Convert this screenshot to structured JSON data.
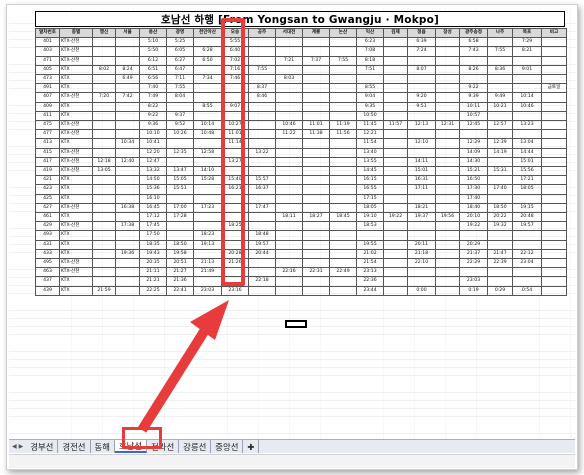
{
  "title": "호남선 하행 [From Yongsan to Gwangju · Mokpo]",
  "columns": [
    "열차번호",
    "종별",
    "행신",
    "서울",
    "용산",
    "광명",
    "천안아산",
    "오송",
    "공주",
    "서대전",
    "계룡",
    "논산",
    "익산",
    "김제",
    "정읍",
    "장성",
    "광주송정",
    "나주",
    "목포",
    "비고"
  ],
  "rows": [
    [
      "401",
      "KTX-산천",
      "",
      "",
      "5:10",
      "5:25",
      "",
      "5:55",
      "",
      "",
      "",
      "",
      "6:23",
      "",
      "6:39",
      "",
      "6:58",
      "",
      "7:29",
      ""
    ],
    [
      "403",
      "KTX-산천",
      "",
      "",
      "5:50",
      "6:05",
      "6:28",
      "6:40",
      "",
      "",
      "",
      "",
      "7:08",
      "",
      "7:24",
      "",
      "7:43",
      "7:55",
      "8:21",
      ""
    ],
    [
      "471",
      "KTX-산천",
      "",
      "",
      "6:12",
      "6:27",
      "6:50",
      "7:02",
      "",
      "7:21",
      "7:37",
      "7:55",
      "8:18",
      "",
      "",
      "",
      "",
      "",
      "",
      ""
    ],
    [
      "405",
      "KTX",
      "8:02",
      "8:24",
      "6:51",
      "6:47",
      "",
      "7:16",
      "7:55",
      "",
      "",
      "",
      "7:51",
      "",
      "8:07",
      "",
      "8:26",
      "8:36",
      "9:01",
      ""
    ],
    [
      "473",
      "KTX",
      "",
      "6:49",
      "6:56",
      "7:11",
      "7:34",
      "7:46",
      "",
      "8:03",
      "",
      "",
      "",
      "",
      "",
      "",
      "",
      "",
      "",
      ""
    ],
    [
      "491",
      "KTX",
      "",
      "",
      "7:40",
      "7:55",
      "",
      "",
      "8:37",
      "",
      "",
      "",
      "8:55",
      "",
      "",
      "",
      "9:22",
      "",
      "",
      "금토일"
    ],
    [
      "407",
      "KTX-산천",
      "7:20",
      "7:42",
      "7:49",
      "8:04",
      "",
      "",
      "8:46",
      "",
      "",
      "",
      "9:04",
      "",
      "9:20",
      "",
      "9:39",
      "9:49",
      "10:14",
      ""
    ],
    [
      "409",
      "KTX",
      "",
      "",
      "8:22",
      "",
      "8:55",
      "9:07",
      "",
      "",
      "",
      "",
      "9:35",
      "",
      "9:51",
      "",
      "10:11",
      "10:21",
      "10:46",
      ""
    ],
    [
      "411",
      "KTX",
      "",
      "",
      "9:22",
      "9:37",
      "",
      "",
      "",
      "",
      "",
      "",
      "10:50",
      "",
      "",
      "",
      "10:57",
      "",
      "",
      ""
    ],
    [
      "475",
      "KTX-산천",
      "",
      "",
      "9:36",
      "9:52",
      "10:14",
      "10:27",
      "",
      "10:46",
      "11:01",
      "11:19",
      "11:45",
      "11:57",
      "12:13",
      "12:31",
      "12:45",
      "12:57",
      "13:23",
      ""
    ],
    [
      "477",
      "KTX-산천",
      "",
      "",
      "10:10",
      "10:26",
      "10:48",
      "11:01",
      "",
      "11:22",
      "11:38",
      "11:56",
      "12:21",
      "",
      "",
      "",
      "",
      "",
      "",
      ""
    ],
    [
      "413",
      "KTX",
      "",
      "10:34",
      "10:41",
      "",
      "",
      "11:14",
      "",
      "",
      "",
      "",
      "11:54",
      "",
      "12:10",
      "",
      "12:29",
      "12:39",
      "13:04",
      ""
    ],
    [
      "415",
      "KTX-산천",
      "",
      "",
      "12:20",
      "12:35",
      "12:58",
      "",
      "13:22",
      "",
      "",
      "",
      "13:40",
      "",
      "",
      "",
      "14:09",
      "14:19",
      "14:44",
      ""
    ],
    [
      "417",
      "KTX-산천",
      "12:18",
      "12:40",
      "12:47",
      "",
      "",
      "13:27",
      "",
      "",
      "",
      "",
      "13:55",
      "",
      "14:11",
      "",
      "14:30",
      "",
      "15:01",
      ""
    ],
    [
      "419",
      "KTX-산천",
      "13:05",
      "",
      "13:32",
      "13:47",
      "14:10",
      "",
      "",
      "",
      "",
      "",
      "14:45",
      "",
      "15:01",
      "",
      "15:21",
      "15:31",
      "15:56",
      ""
    ],
    [
      "421",
      "KTX",
      "",
      "",
      "14:50",
      "15:05",
      "15:28",
      "15:40",
      "15:57",
      "",
      "",
      "",
      "16:15",
      "",
      "16:31",
      "",
      "16:50",
      "",
      "17:21",
      ""
    ],
    [
      "423",
      "KTX",
      "",
      "",
      "15:36",
      "15:51",
      "",
      "16:21",
      "16:37",
      "",
      "",
      "",
      "16:55",
      "",
      "17:11",
      "",
      "17:30",
      "17:40",
      "18:05",
      ""
    ],
    [
      "425",
      "KTX",
      "",
      "",
      "16:10",
      "",
      "",
      "",
      "",
      "",
      "",
      "",
      "17:15",
      "",
      "",
      "",
      "17:40",
      "",
      "",
      ""
    ],
    [
      "427",
      "KTX-산천",
      "",
      "16:38",
      "16:45",
      "17:00",
      "17:23",
      "",
      "17:47",
      "",
      "",
      "",
      "18:05",
      "",
      "18:21",
      "",
      "18:40",
      "18:50",
      "19:15",
      ""
    ],
    [
      "461",
      "KTX",
      "",
      "",
      "17:12",
      "17:28",
      "",
      "",
      "",
      "18:11",
      "18:27",
      "18:45",
      "19:10",
      "19:22",
      "19:37",
      "19:56",
      "20:10",
      "20:22",
      "20:48",
      ""
    ],
    [
      "429",
      "KTX-산천",
      "",
      "17:38",
      "17:45",
      "",
      "",
      "18:25",
      "",
      "",
      "",
      "",
      "18:53",
      "",
      "",
      "",
      "19:22",
      "19:32",
      "19:57",
      ""
    ],
    [
      "493",
      "KTX",
      "",
      "",
      "17:50",
      "",
      "18:23",
      "",
      "18:48",
      "",
      "",
      "",
      "",
      "",
      "",
      "",
      "",
      "",
      "",
      ""
    ],
    [
      "431",
      "KTX",
      "",
      "",
      "18:35",
      "18:50",
      "19:13",
      "",
      "19:57",
      "",
      "",
      "",
      "19:55",
      "",
      "20:11",
      "",
      "20:29",
      "",
      "",
      ""
    ],
    [
      "433",
      "KTX",
      "",
      "19:36",
      "19:43",
      "19:58",
      "",
      "20:28",
      "20:44",
      "",
      "",
      "",
      "21:02",
      "",
      "21:18",
      "",
      "21:37",
      "21:47",
      "22:12",
      ""
    ],
    [
      "495",
      "KTX-산천",
      "",
      "",
      "20:35",
      "20:51",
      "21:13",
      "21:26",
      "",
      "",
      "",
      "",
      "21:54",
      "",
      "22:10",
      "",
      "22:29",
      "22:39",
      "23:04",
      ""
    ],
    [
      "463",
      "KTX-산천",
      "",
      "",
      "21:11",
      "21:27",
      "21:49",
      "",
      "",
      "22:16",
      "22:31",
      "22:49",
      "23:13",
      "",
      "",
      "",
      "",
      "",
      "",
      ""
    ],
    [
      "437",
      "KTX",
      "",
      "",
      "21:21",
      "21:36",
      "",
      "",
      "22:18",
      "",
      "",
      "",
      "22:36",
      "",
      "",
      "",
      "23:03",
      "",
      "",
      ""
    ],
    [
      "439",
      "KTX",
      "21:59",
      "",
      "22:25",
      "22:41",
      "23:03",
      "23:16",
      "",
      "",
      "",
      "",
      "23:44",
      "",
      "0:00",
      "",
      "0:19",
      "0:29",
      "0:54",
      ""
    ]
  ],
  "tabs": [
    {
      "label": "경부선",
      "active": false
    },
    {
      "label": "경전선",
      "active": false
    },
    {
      "label": "동해",
      "active": false
    },
    {
      "label": "호남선",
      "active": true
    },
    {
      "label": "전라선",
      "active": false
    },
    {
      "label": "강릉선",
      "active": false
    },
    {
      "label": "중앙선",
      "active": false
    }
  ],
  "colors": {
    "highlight": "#e83b3b",
    "header_bg": "#d9d9d9",
    "tab_active_underline": "#3a6bc1"
  }
}
